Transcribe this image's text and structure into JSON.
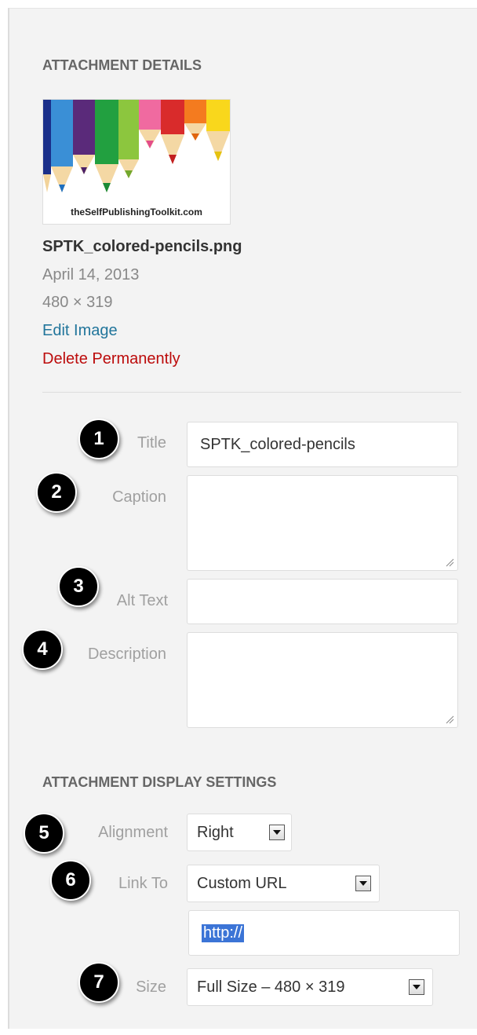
{
  "attachment_details": {
    "heading": "ATTACHMENT DETAILS",
    "thumbnail_caption": "theSelfPublishingToolkit.com",
    "filename": "SPTK_colored-pencils.png",
    "date": "April 14, 2013",
    "dimensions": "480 × 319",
    "edit_link": "Edit Image",
    "delete_link": "Delete Permanently"
  },
  "fields": {
    "title": {
      "label": "Title",
      "value": "SPTK_colored-pencils",
      "badge": "1"
    },
    "caption": {
      "label": "Caption",
      "value": "",
      "badge": "2"
    },
    "alt_text": {
      "label": "Alt Text",
      "value": "",
      "badge": "3"
    },
    "description": {
      "label": "Description",
      "value": "",
      "badge": "4"
    }
  },
  "display_settings": {
    "heading": "ATTACHMENT DISPLAY SETTINGS",
    "alignment": {
      "label": "Alignment",
      "value": "Right",
      "badge": "5"
    },
    "link_to": {
      "label": "Link To",
      "value": "Custom URL",
      "badge": "6",
      "url": "http://"
    },
    "size": {
      "label": "Size",
      "value": "Full Size – 480 × 319",
      "badge": "7"
    }
  },
  "colors": {
    "link": "#21759b",
    "danger": "#bc0b0b",
    "panel_bg": "#f3f3f3",
    "badge_bg": "#000000",
    "selection": "#3b74d6"
  },
  "icons": [
    "pencil-thumbnail-image",
    "resize-grip-icon",
    "dropdown-arrow-icon"
  ]
}
